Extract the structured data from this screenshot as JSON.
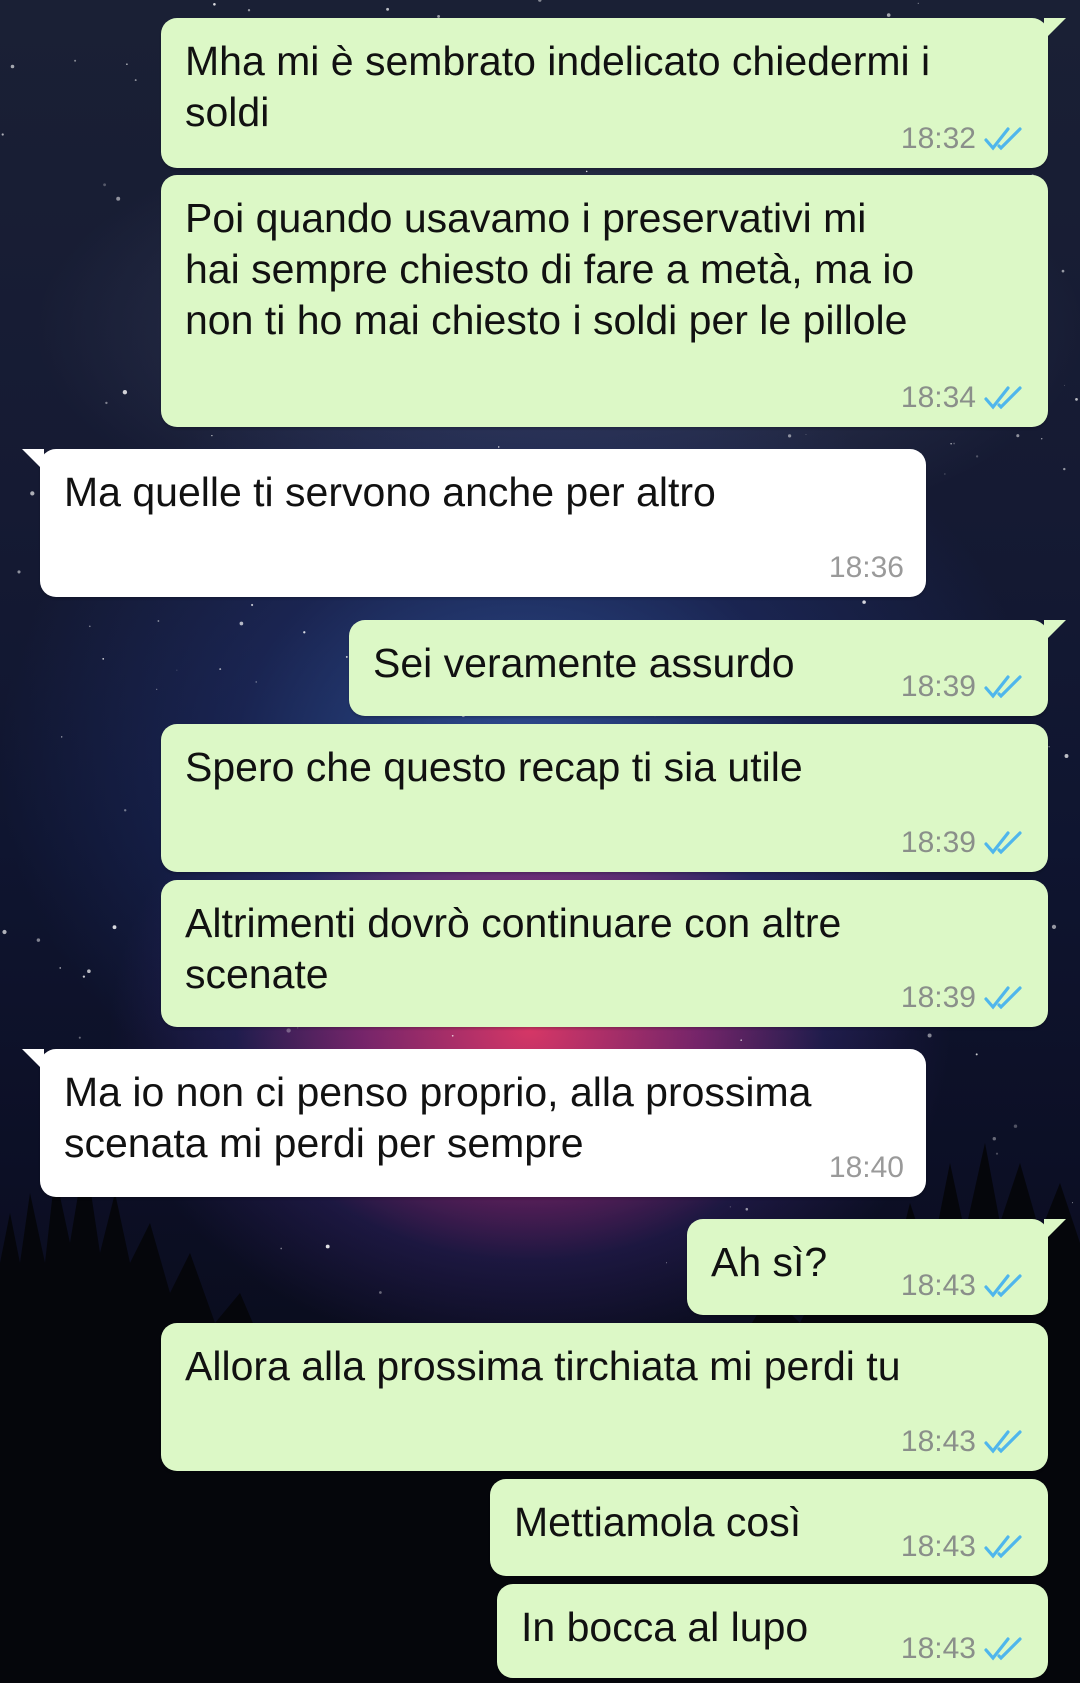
{
  "colors": {
    "outgoing_bubble": "#dcf8c6",
    "incoming_bubble": "#ffffff",
    "read_ticks": "#4fb6ec",
    "time_text": "#8a8f8a"
  },
  "messages": [
    {
      "dir": "out",
      "text": "Mha mi è sembrato indelicato chiedermi i\nsoldi",
      "time": "18:32",
      "status_icon": "double-check-read-icon"
    },
    {
      "dir": "out",
      "text": "Poi quando usavamo i preservativi mi\nhai sempre chiesto di fare a metà, ma io\nnon ti ho mai chiesto i soldi per le pillole",
      "time": "18:34",
      "status_icon": "double-check-read-icon"
    },
    {
      "dir": "in",
      "text": "Ma quelle ti servono anche per altro",
      "time": "18:36"
    },
    {
      "dir": "out",
      "text": "Sei veramente assurdo",
      "time": "18:39",
      "status_icon": "double-check-read-icon"
    },
    {
      "dir": "out",
      "text": "Spero che questo recap ti sia utile",
      "time": "18:39",
      "status_icon": "double-check-read-icon"
    },
    {
      "dir": "out",
      "text": "Altrimenti dovrò continuare con altre\nscenate",
      "time": "18:39",
      "status_icon": "double-check-read-icon"
    },
    {
      "dir": "in",
      "text": "Ma io non ci penso proprio, alla prossima\nscenata mi perdi per sempre",
      "time": "18:40"
    },
    {
      "dir": "out",
      "text": "Ah sì?",
      "time": "18:43",
      "status_icon": "double-check-read-icon"
    },
    {
      "dir": "out",
      "text": "Allora alla prossima tirchiata mi perdi tu",
      "time": "18:43",
      "status_icon": "double-check-read-icon"
    },
    {
      "dir": "out",
      "text": "Mettiamola così",
      "time": "18:43",
      "status_icon": "double-check-read-icon"
    },
    {
      "dir": "out",
      "text": "In bocca al lupo",
      "time": "18:43",
      "status_icon": "double-check-read-icon"
    }
  ]
}
